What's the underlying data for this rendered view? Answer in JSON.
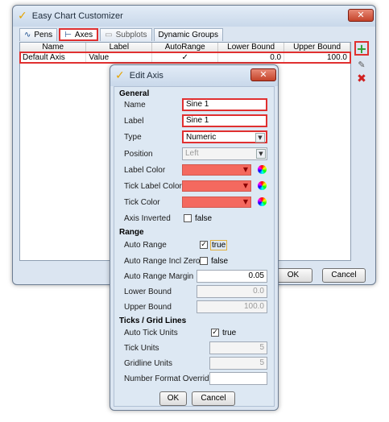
{
  "main": {
    "title": "Easy Chart Customizer",
    "tabs": [
      {
        "label": "Pens",
        "icon": "pens-icon"
      },
      {
        "label": "Axes",
        "icon": "axes-icon"
      },
      {
        "label": "Subplots",
        "icon": "subplots-icon"
      },
      {
        "label": "Dynamic Groups",
        "icon": ""
      }
    ],
    "table": {
      "headers": [
        "Name",
        "Label",
        "AutoRange",
        "Lower Bound",
        "Upper Bound"
      ],
      "rows": [
        {
          "name": "Default Axis",
          "label": "Value",
          "autorange": "✓",
          "lower": "0.0",
          "upper": "100.0"
        }
      ]
    },
    "buttons": {
      "ok": "OK",
      "cancel": "Cancel"
    }
  },
  "dialog": {
    "title": "Edit Axis",
    "sections": {
      "general": "General",
      "range": "Range",
      "ticks": "Ticks / Grid Lines"
    },
    "fields": {
      "name_label": "Name",
      "name_value": "Sine 1",
      "label_label": "Label",
      "label_value": "Sine 1",
      "type_label": "Type",
      "type_value": "Numeric",
      "position_label": "Position",
      "position_value": "Left",
      "label_color_label": "Label Color",
      "tick_label_color_label": "Tick Label Color",
      "tick_color_label": "Tick Color",
      "axis_inverted_label": "Axis Inverted",
      "axis_inverted_value": "false",
      "auto_range_label": "Auto Range",
      "auto_range_value": "true",
      "auto_range_zero_label": "Auto Range Incl Zero",
      "auto_range_zero_value": "false",
      "auto_range_margin_label": "Auto Range Margin",
      "auto_range_margin_value": "0.05",
      "lower_bound_label": "Lower Bound",
      "lower_bound_value": "0.0",
      "upper_bound_label": "Upper Bound",
      "upper_bound_value": "100.0",
      "auto_tick_units_label": "Auto Tick Units",
      "auto_tick_units_value": "true",
      "tick_units_label": "Tick Units",
      "tick_units_value": "5",
      "gridline_units_label": "Gridline Units",
      "gridline_units_value": "5",
      "number_format_label": "Number Format Override",
      "number_format_value": ""
    },
    "buttons": {
      "ok": "OK",
      "cancel": "Cancel"
    }
  },
  "colors": {
    "selection_outline": "#e03030",
    "color_swatch": "#f4695f",
    "window_bg": "#dbe5f1"
  }
}
